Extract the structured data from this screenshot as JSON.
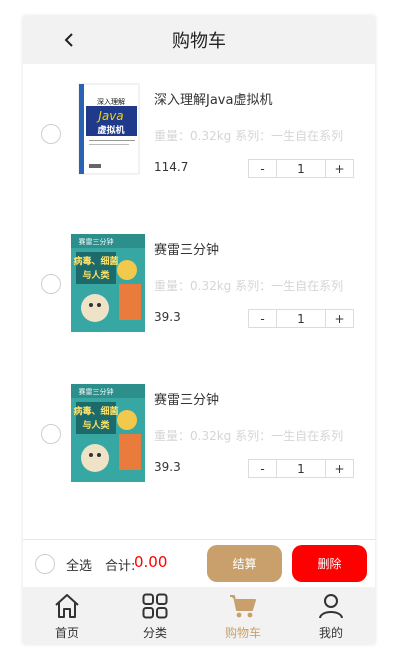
{
  "header": {
    "title": "购物车"
  },
  "items": [
    {
      "name": "深入理解Java虚拟机",
      "meta": "重量：0.32kg 系列：一生自在系列",
      "price": "114.7",
      "qty": "1",
      "cover": {
        "title": "深入理解",
        "subtitle": "Java",
        "subtitle2": "虚拟机"
      }
    },
    {
      "name": "赛雷三分钟",
      "meta": "重量：0.32kg 系列：一生自在系列",
      "price": "39.3",
      "qty": "1",
      "cover": {
        "title": "赛雷三分钟",
        "subtitle": "病毒、细菌",
        "subtitle2": "与人类"
      }
    },
    {
      "name": "赛雷三分钟",
      "meta": "重量：0.32kg 系列：一生自在系列",
      "price": "39.3",
      "qty": "1",
      "cover": {
        "title": "赛雷三分钟",
        "subtitle": "病毒、细菌",
        "subtitle2": "与人类"
      }
    }
  ],
  "stepper": {
    "minus": "-",
    "plus": "+"
  },
  "footer": {
    "select_all": "全选",
    "total_label": "合计:",
    "total_value": "0.00",
    "pay": "结算",
    "delete": "删除"
  },
  "tabs": [
    {
      "label": "首页",
      "icon": "home-icon"
    },
    {
      "label": "分类",
      "icon": "grid-icon"
    },
    {
      "label": "购物车",
      "icon": "cart-icon",
      "active": true
    },
    {
      "label": "我的",
      "icon": "user-icon"
    }
  ],
  "colors": {
    "accent": "#c9a06b",
    "danger": "#ff0000",
    "header_bg": "#f2f2f2",
    "meta_text": "#d5d5d5"
  }
}
